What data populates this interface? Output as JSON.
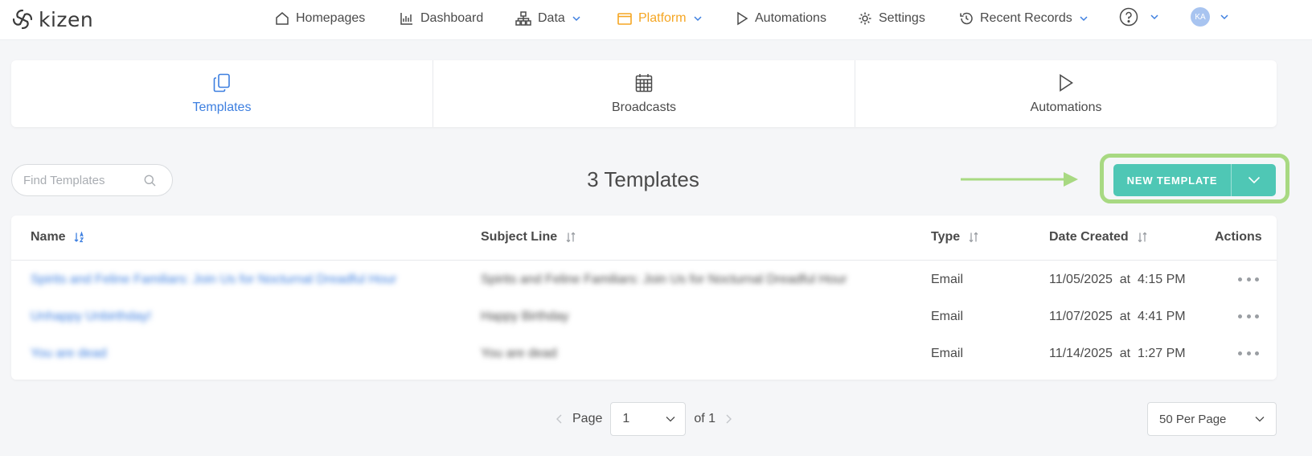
{
  "brand": {
    "name": "kizen"
  },
  "nav": {
    "items": [
      {
        "label": "Homepages",
        "icon": "home-icon"
      },
      {
        "label": "Dashboard",
        "icon": "bar-chart-icon"
      },
      {
        "label": "Data",
        "icon": "sitemap-icon"
      },
      {
        "label": "Platform",
        "icon": "window-icon",
        "active": true
      },
      {
        "label": "Automations",
        "icon": "play-icon"
      },
      {
        "label": "Settings",
        "icon": "gear-icon"
      },
      {
        "label": "Recent Records",
        "icon": "history-icon"
      }
    ],
    "help_icon": "question-circle-icon",
    "avatar_initials": "KA"
  },
  "section_tabs": [
    {
      "label": "Templates",
      "icon": "copy-icon",
      "active": true
    },
    {
      "label": "Broadcasts",
      "icon": "calendar-icon"
    },
    {
      "label": "Automations",
      "icon": "play-icon"
    }
  ],
  "search": {
    "placeholder": "Find Templates",
    "value": ""
  },
  "list_title": "3 Templates",
  "new_button": {
    "label": "NEW TEMPLATE"
  },
  "table": {
    "columns": [
      "Name",
      "Subject Line",
      "Type",
      "Date Created",
      "Actions"
    ],
    "rows": [
      {
        "name": "Spirits and Feline Familiars: Join Us for Nocturnal Dreadful Hour",
        "subject": "Spirits and Feline Familiars: Join Us for Nocturnal Dreadful Hour",
        "type": "Email",
        "date_created": "11/05/2025  at  4:15 PM"
      },
      {
        "name": "Unhappy Unbirthday!",
        "subject": "Happy Birthday",
        "type": "Email",
        "date_created": "11/07/2025  at  4:41 PM"
      },
      {
        "name": "You are dead",
        "subject": "You are dead",
        "type": "Email",
        "date_created": "11/14/2025  at  1:27 PM"
      }
    ]
  },
  "pagination": {
    "page_label": "Page",
    "current_page": "1",
    "of_label": "of 1",
    "per_page": "50 Per Page"
  },
  "colors": {
    "accent_blue": "#3d7fe0",
    "platform_orange": "#f5a623",
    "button_teal": "#4fc7b5",
    "highlight_green": "#a8d982"
  }
}
